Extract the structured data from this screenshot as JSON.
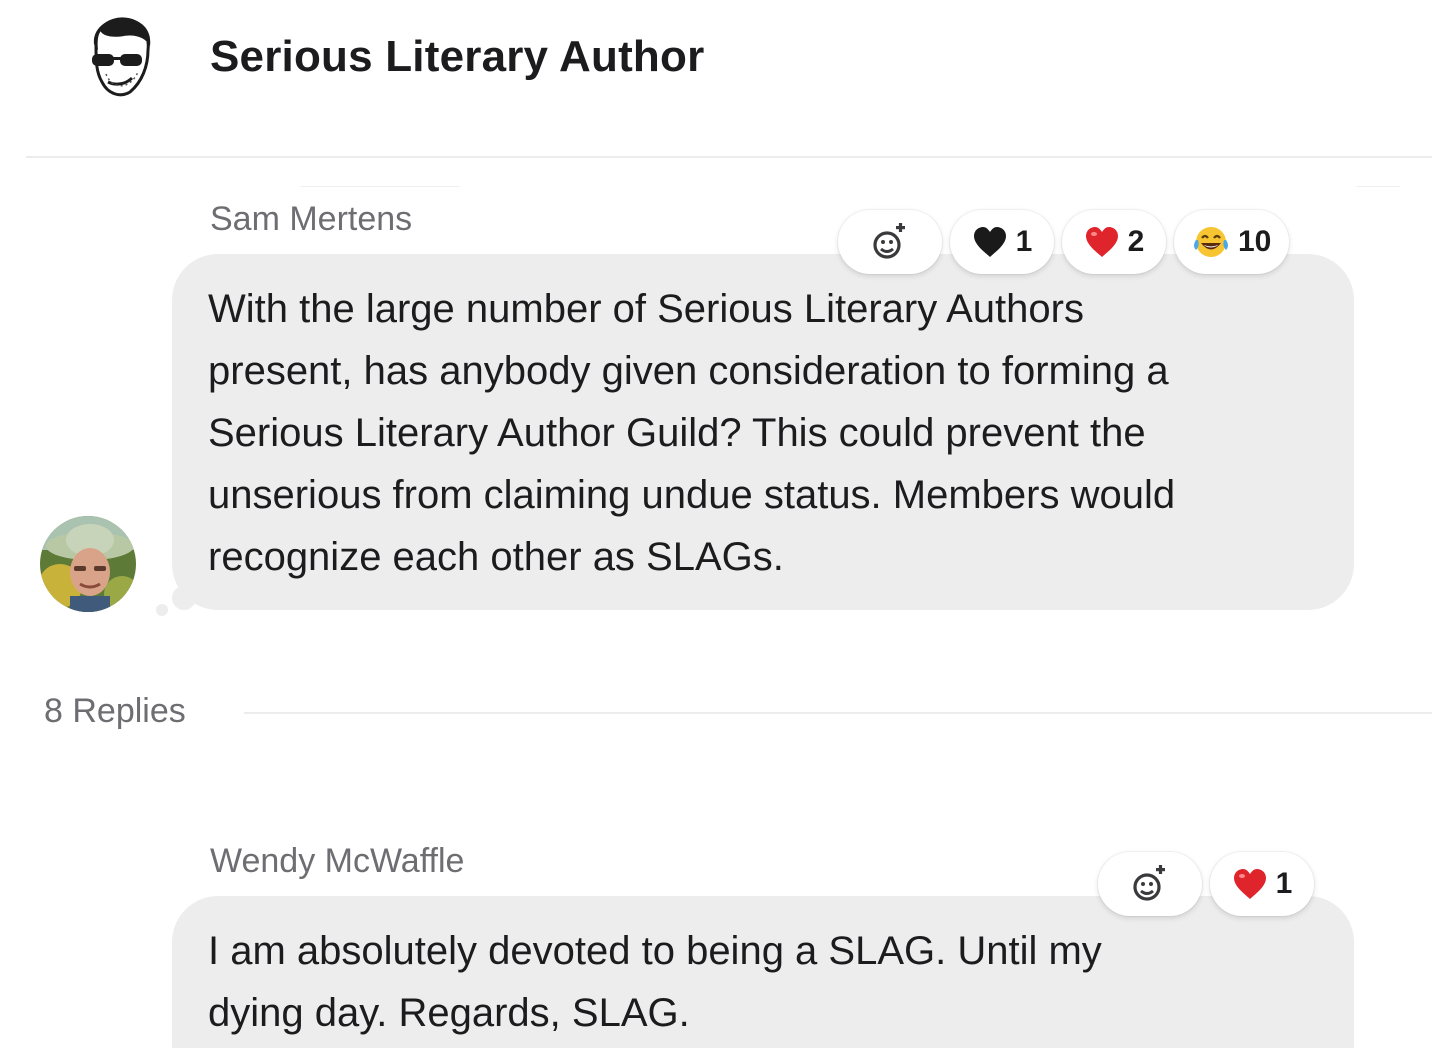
{
  "channel": {
    "title": "Serious Literary Author",
    "avatar_icon": "author-avatar"
  },
  "message": {
    "sender": "Sam Mertens",
    "text": "With the large number of Serious Literary Authors\npresent, has anybody given consideration to forming a\nSerious Literary Author Guild? This could prevent the\nunserious from claiming undue status. Members would\nrecognize each other as SLAGs.",
    "reactions": [
      {
        "icon": "black-heart-icon",
        "count": "1"
      },
      {
        "icon": "red-heart-icon",
        "count": "2"
      },
      {
        "icon": "laughing-tears-icon",
        "count": "10"
      }
    ]
  },
  "replies": {
    "label": "8 Replies"
  },
  "reply": {
    "sender": "Wendy McWaffle",
    "text": "I am absolutely devoted to being a SLAG. Until my\ndying day. Regards, SLAG.",
    "reactions": [
      {
        "icon": "red-heart-icon",
        "count": "1"
      }
    ]
  },
  "colors": {
    "bubble": "#ededee",
    "heart_red": "#e0242c",
    "secondary_text": "#6d6d72"
  }
}
